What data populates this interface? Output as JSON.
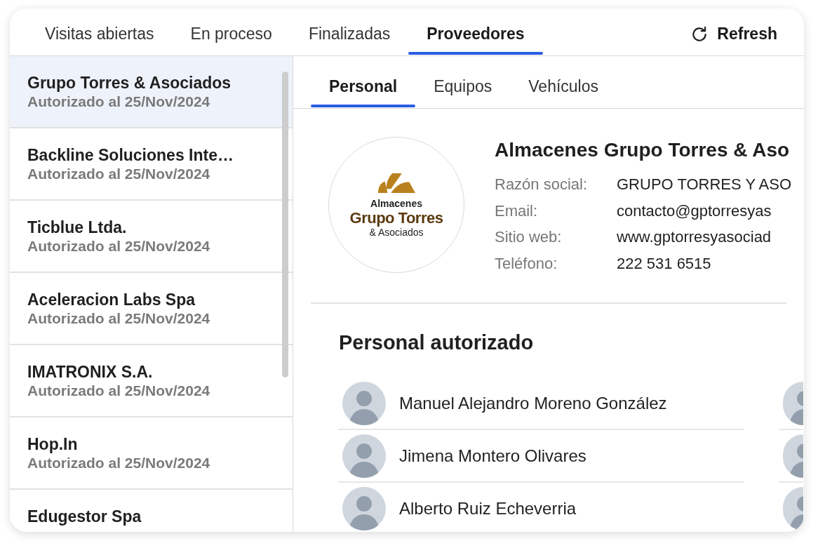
{
  "top_tabs": [
    {
      "label": "Visitas abiertas",
      "selected": false
    },
    {
      "label": "En proceso",
      "selected": false
    },
    {
      "label": "Finalizadas",
      "selected": false
    },
    {
      "label": "Proveedores",
      "selected": true
    }
  ],
  "refresh": {
    "label": "Refresh"
  },
  "suppliers": [
    {
      "name": "Grupo Torres & Asociados",
      "date": "Autorizado al 25/Nov/2024",
      "selected": true
    },
    {
      "name": "Backline Soluciones Inte…",
      "date": "Autorizado al 25/Nov/2024",
      "selected": false
    },
    {
      "name": "Ticblue Ltda.",
      "date": "Autorizado al 25/Nov/2024",
      "selected": false
    },
    {
      "name": "Aceleracion Labs Spa",
      "date": "Autorizado al 25/Nov/2024",
      "selected": false
    },
    {
      "name": "IMATRONIX S.A.",
      "date": "Autorizado al 25/Nov/2024",
      "selected": false
    },
    {
      "name": "Hop.In",
      "date": "Autorizado al 25/Nov/2024",
      "selected": false
    },
    {
      "name": "Edugestor Spa",
      "selected": false
    }
  ],
  "detail": {
    "tabs": [
      {
        "label": "Personal",
        "selected": true
      },
      {
        "label": "Equipos",
        "selected": false
      },
      {
        "label": "Vehículos",
        "selected": false
      }
    ],
    "logo": {
      "lines": [
        {
          "text": "Almacenes",
          "kind": "caption"
        },
        {
          "text": "Grupo Torres",
          "kind": "brand"
        },
        {
          "text": "& Asociados",
          "kind": "tagline"
        }
      ]
    },
    "company_name": "Almacenes Grupo Torres & Aso",
    "fields": [
      {
        "label": "Razón social:",
        "value": "GRUPO TORRES Y ASO"
      },
      {
        "label": "Email:",
        "value": "contacto@gptorresyas"
      },
      {
        "label": "Sitio web:",
        "value": "www.gptorresyasociad"
      },
      {
        "label": "Teléfono:",
        "value": "222 531 6515"
      }
    ],
    "staff_title": "Personal autorizado",
    "staff": [
      {
        "name": "Manuel Alejandro Moreno González",
        "photo": true
      },
      {
        "name": "Jimena Montero Olivares",
        "photo": true
      },
      {
        "name": "Alberto Ruiz Echeverria",
        "photo": true
      }
    ],
    "staff_column_2": [
      {
        "photo": true
      },
      {
        "photo": true
      },
      {
        "photo": true
      }
    ]
  }
}
